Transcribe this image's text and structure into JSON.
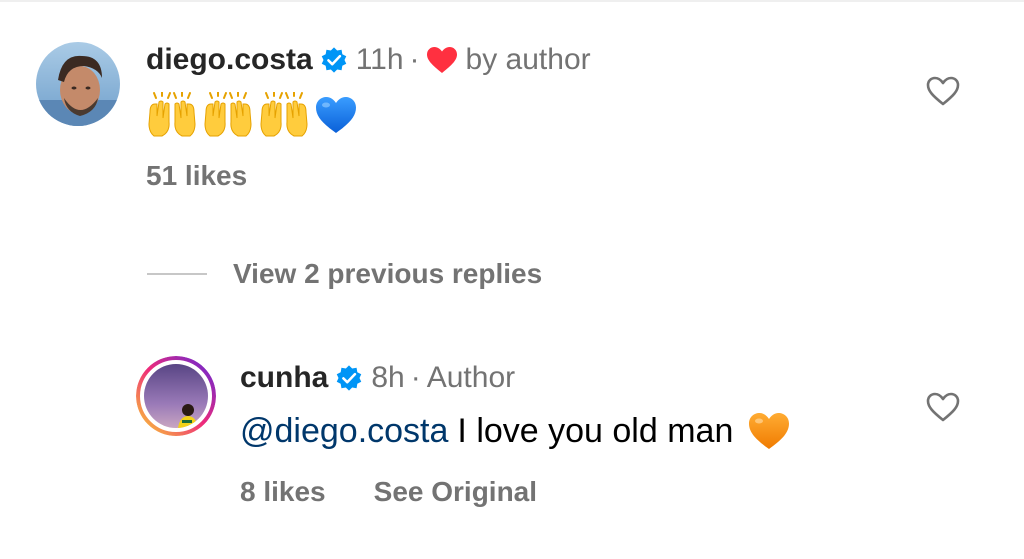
{
  "comments": [
    {
      "username": "diego.costa",
      "verified": true,
      "time": "11h",
      "separator": "·",
      "liked_by_author_label": "by author",
      "reaction_emojis": [
        "raising-hands-emoji",
        "raising-hands-emoji",
        "raising-hands-emoji",
        "blue-heart-emoji"
      ],
      "likes": "51 likes",
      "icons": {
        "verified": "verified-badge-icon",
        "liked": "red-heart-icon",
        "like": "heart-outline-icon"
      }
    },
    {
      "username": "cunha",
      "verified": true,
      "time": "8h",
      "separator": "·",
      "author_label": "Author",
      "mention": "@diego.costa",
      "text": "I love you old man",
      "reaction_emojis": [
        "orange-heart-emoji"
      ],
      "likes": "8 likes",
      "see_original": "See Original",
      "icons": {
        "verified": "verified-badge-icon",
        "like": "heart-outline-icon"
      }
    }
  ],
  "view_replies": {
    "label": "View 2 previous replies"
  },
  "colors": {
    "text_primary": "#262626",
    "text_secondary": "#737373",
    "mention": "#00376b",
    "verified_blue": "#0095f6",
    "liked_red": "#ff3040",
    "story_ring_start": "#f9ce34",
    "story_ring_mid": "#ee2a7b",
    "story_ring_end": "#6228d7"
  }
}
